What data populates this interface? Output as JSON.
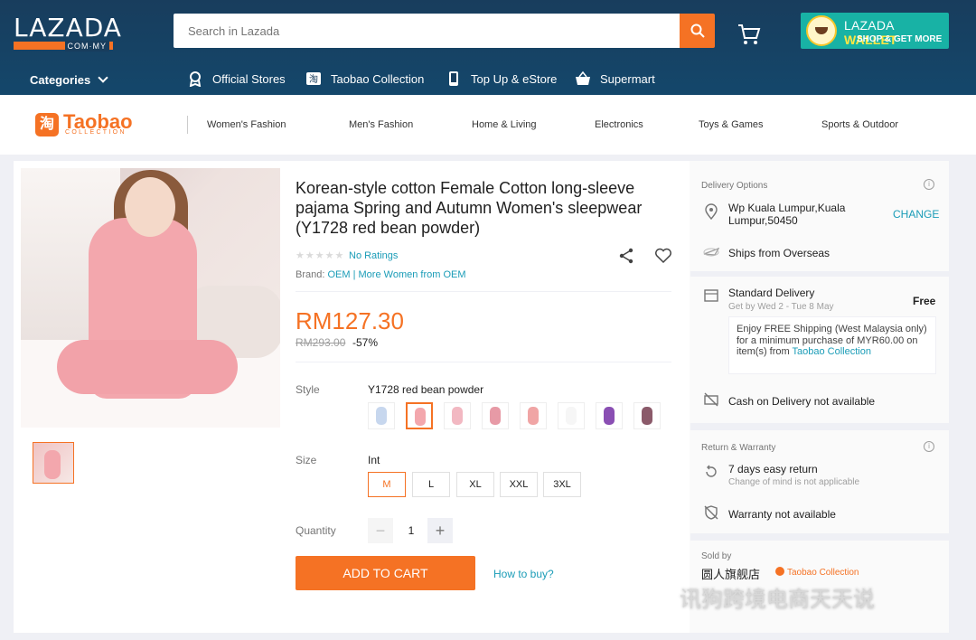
{
  "header": {
    "logo": "LAZADA",
    "logo_sub": "COM·MY",
    "search_placeholder": "Search in Lazada",
    "wallet_title_a": "LAZADA",
    "wallet_title_b": "WALLET",
    "wallet_sub": "SHOP & GET MORE",
    "categories": "Categories",
    "nav": [
      "Official Stores",
      "Taobao Collection",
      "Top Up & eStore",
      "Supermart"
    ],
    "accent": "#f57224",
    "bg": "#183d5d"
  },
  "catbar": {
    "logo": "Taobao",
    "logo_char": "淘",
    "logo_sub": "COLLECTION",
    "links": [
      "Women's Fashion",
      "Men's Fashion",
      "Home & Living",
      "Electronics",
      "Toys & Games",
      "Sports & Outdoor"
    ]
  },
  "product": {
    "title": "Korean-style cotton Female Cotton long-sleeve pajama Spring and Autumn Women's sleepwear (Y1728 red bean powder)",
    "stars": "★★★★★",
    "ratings": "No Ratings",
    "brand_label": "Brand:",
    "brand": "OEM",
    "more": "| More Women from OEM",
    "price": "RM127.30",
    "old_price": "RM293.00",
    "discount": "-57%",
    "style_label": "Style",
    "style_value": "Y1728 red bean powder",
    "size_label": "Size",
    "size_value": "Int",
    "sizes": [
      "M",
      "L",
      "XL",
      "XXL",
      "3XL"
    ],
    "quantity_label": "Quantity",
    "quantity": "1",
    "minus": "−",
    "plus": "+",
    "add_to_cart": "ADD TO CART",
    "how_to_buy": "How to buy?"
  },
  "side": {
    "delivery_header": "Delivery Options",
    "location": "Wp Kuala Lumpur,Kuala Lumpur,50450",
    "change": "CHANGE",
    "ships": "Ships from Overseas",
    "standard": "Standard Delivery",
    "standard_sub": "Get by Wed 2 - Tue 8 May",
    "free": "Free",
    "free_text": "Enjoy FREE Shipping (West Malaysia only) for a minimum purchase of MYR60.00 on item(s) from",
    "free_link": "Taobao Collection",
    "cod": "Cash on Delivery not available",
    "return_header": "Return & Warranty",
    "return": "7 days easy return",
    "return_sub": "Change of mind is not applicable",
    "warranty": "Warranty not available",
    "sold_by": "Sold by",
    "seller": "圆人旗舰店",
    "seller_badge": "Taobao Collection",
    "watermark": "讯狗跨境电商天天说"
  }
}
